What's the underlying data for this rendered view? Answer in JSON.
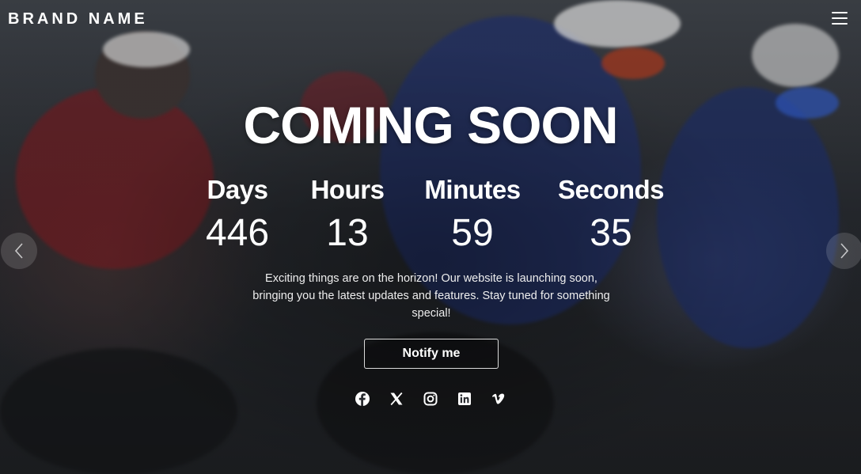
{
  "header": {
    "brand": "BRAND NAME",
    "menu_icon": "hamburger-menu-icon"
  },
  "hero": {
    "title": "COMING SOON",
    "countdown": [
      {
        "label": "Days",
        "value": "446"
      },
      {
        "label": "Hours",
        "value": "13"
      },
      {
        "label": "Minutes",
        "value": "59"
      },
      {
        "label": "Seconds",
        "value": "35"
      }
    ],
    "description": "Exciting things are on the horizon! Our website is launching soon, bringing you the latest updates and features. Stay tuned for something special!",
    "notify_label": "Notify me"
  },
  "carousel": {
    "prev_icon": "chevron-left-icon",
    "next_icon": "chevron-right-icon"
  },
  "social": [
    "facebook-icon",
    "x-icon",
    "instagram-icon",
    "linkedin-icon",
    "vimeo-icon"
  ],
  "colors": {
    "text": "#ffffff",
    "overlay": "#000000"
  }
}
